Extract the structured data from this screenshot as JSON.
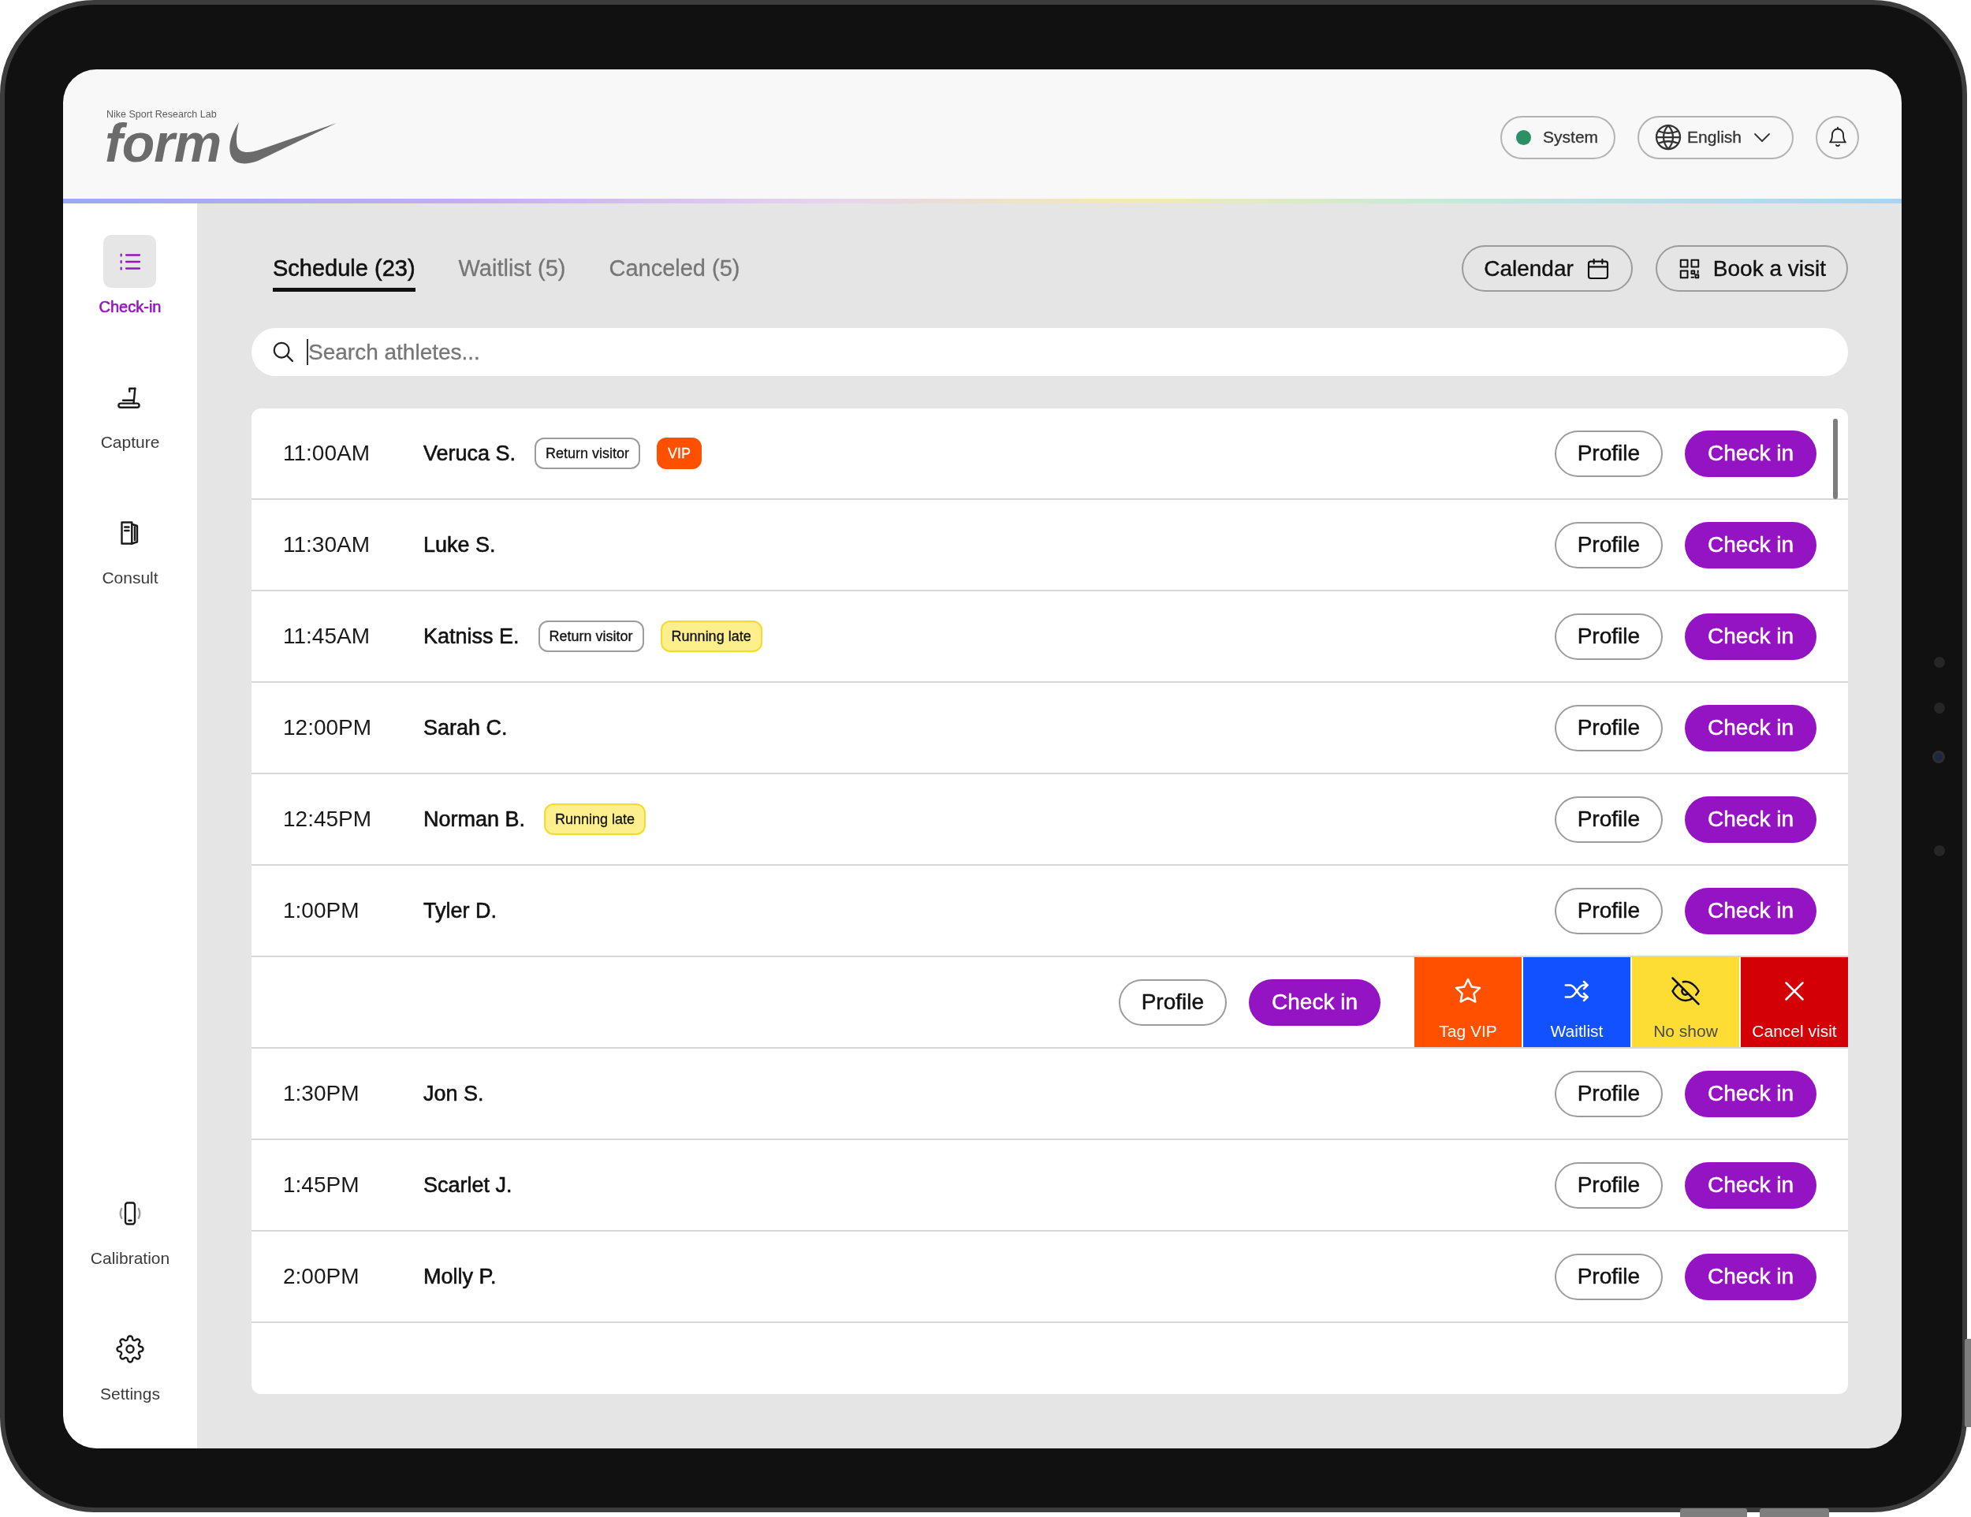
{
  "header": {
    "logo": {
      "tagline": "Nike Sport Research Lab",
      "wordmark": "form"
    },
    "system": {
      "label": "System",
      "color": "#2a9164"
    },
    "language": {
      "value": "English"
    }
  },
  "sidebar": {
    "items": [
      {
        "label": "Check-in",
        "kind": "checkin",
        "selected": true
      },
      {
        "label": "Capture",
        "kind": "capture",
        "selected": false
      },
      {
        "label": "Consult",
        "kind": "consult",
        "selected": false
      }
    ],
    "bottom_items": [
      {
        "label": "Calibration",
        "kind": "calibration",
        "selected": false
      },
      {
        "label": "Settings",
        "kind": "settings",
        "selected": false
      }
    ]
  },
  "tabs": [
    {
      "label": "Schedule (23)",
      "selected": true
    },
    {
      "label": "Waitlist (5)",
      "selected": false
    },
    {
      "label": "Canceled (5)",
      "selected": false
    }
  ],
  "toolbar": {
    "buttons": [
      {
        "label": "Calendar",
        "kind": "calendar"
      },
      {
        "label": "Book a visit",
        "kind": "book"
      }
    ]
  },
  "search": {
    "placeholder": "Search athletes...",
    "focused": true
  },
  "schedule": {
    "rows": [
      {
        "kind": "visit",
        "time": "11:00AM",
        "name": "Veruca S.",
        "tags": [
          {
            "label": "Return visitor",
            "kind": "outline"
          },
          {
            "label": "VIP",
            "kind": "vip"
          }
        ],
        "buttons": [
          "Profile",
          "Check in"
        ]
      },
      {
        "kind": "visit",
        "time": "11:30AM",
        "name": "Luke S.",
        "buttons": [
          "Profile",
          "Check in"
        ]
      },
      {
        "kind": "visit",
        "time": "11:45AM",
        "name": "Katniss E.",
        "tags": [
          {
            "label": "Return visitor",
            "kind": "outline"
          },
          {
            "label": "Running late",
            "kind": "late"
          }
        ],
        "buttons": [
          "Profile",
          "Check in"
        ]
      },
      {
        "kind": "visit",
        "time": "12:00PM",
        "name": "Sarah C.",
        "buttons": [
          "Profile",
          "Check in"
        ]
      },
      {
        "kind": "visit",
        "time": "12:45PM",
        "name": "Norman B.",
        "tags": [
          {
            "label": "Running late",
            "kind": "late"
          }
        ],
        "buttons": [
          "Profile",
          "Check in"
        ]
      },
      {
        "kind": "visit",
        "time": "1:00PM",
        "name": "Tyler D.",
        "buttons": [
          "Profile",
          "Check in"
        ]
      },
      {
        "kind": "swiped",
        "buttons": [
          "Profile",
          "Check in"
        ],
        "actions": [
          {
            "label": "Tag VIP",
            "kind": "vip",
            "color": "#ff5000"
          },
          {
            "label": "Waitlist",
            "kind": "waitlist",
            "color": "#1151ff"
          },
          {
            "label": "No show",
            "kind": "noshow",
            "color": "#fddc33"
          },
          {
            "label": "Cancel visit",
            "kind": "cancel",
            "color": "#d30005"
          }
        ]
      },
      {
        "kind": "visit",
        "time": "1:30PM",
        "name": "Jon S.",
        "buttons": [
          "Profile",
          "Check in"
        ]
      },
      {
        "kind": "visit",
        "time": "1:45PM",
        "name": "Scarlet J.",
        "buttons": [
          "Profile",
          "Check in"
        ]
      },
      {
        "kind": "visit",
        "time": "2:00PM",
        "name": "Molly P.",
        "buttons": [
          "Profile",
          "Check in"
        ]
      }
    ]
  }
}
